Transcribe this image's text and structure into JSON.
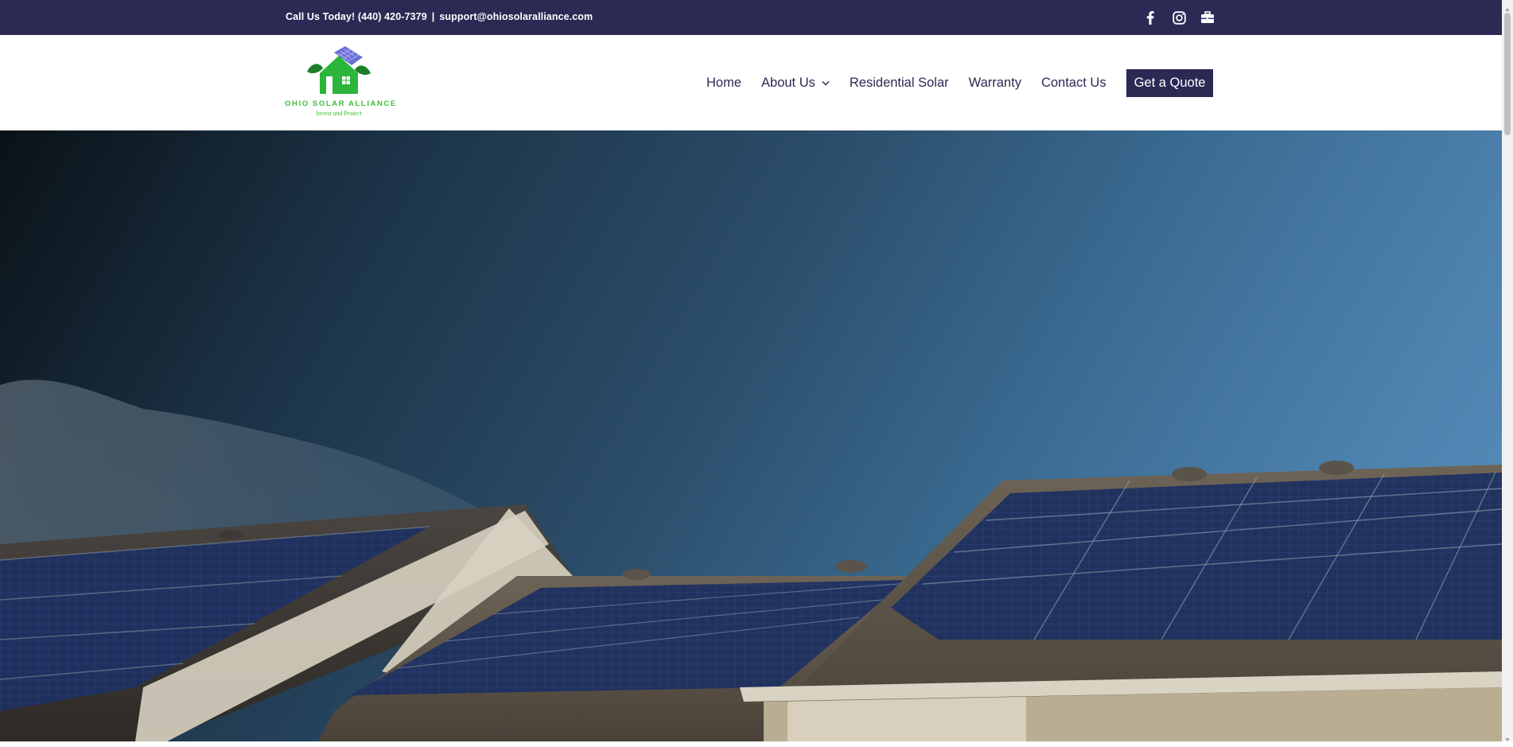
{
  "topbar": {
    "phone_text": "Call Us Today! (440) 420-7379",
    "separator": "|",
    "email": "support@ohiosolaralliance.com",
    "social": [
      "facebook-icon",
      "instagram-icon",
      "briefcase-icon"
    ]
  },
  "logo": {
    "brand": "OHIO SOLAR ALLIANCE",
    "tagline": "Invest and Protect"
  },
  "nav": {
    "items": [
      {
        "label": "Home"
      },
      {
        "label": "About Us",
        "has_dropdown": true
      },
      {
        "label": "Residential Solar"
      },
      {
        "label": "Warranty"
      },
      {
        "label": "Contact Us"
      }
    ],
    "cta": "Get a Quote"
  },
  "colors": {
    "brand_navy": "#2b2a55",
    "logo_green": "#3cbf3c",
    "panel_blue": "#1e3060"
  }
}
